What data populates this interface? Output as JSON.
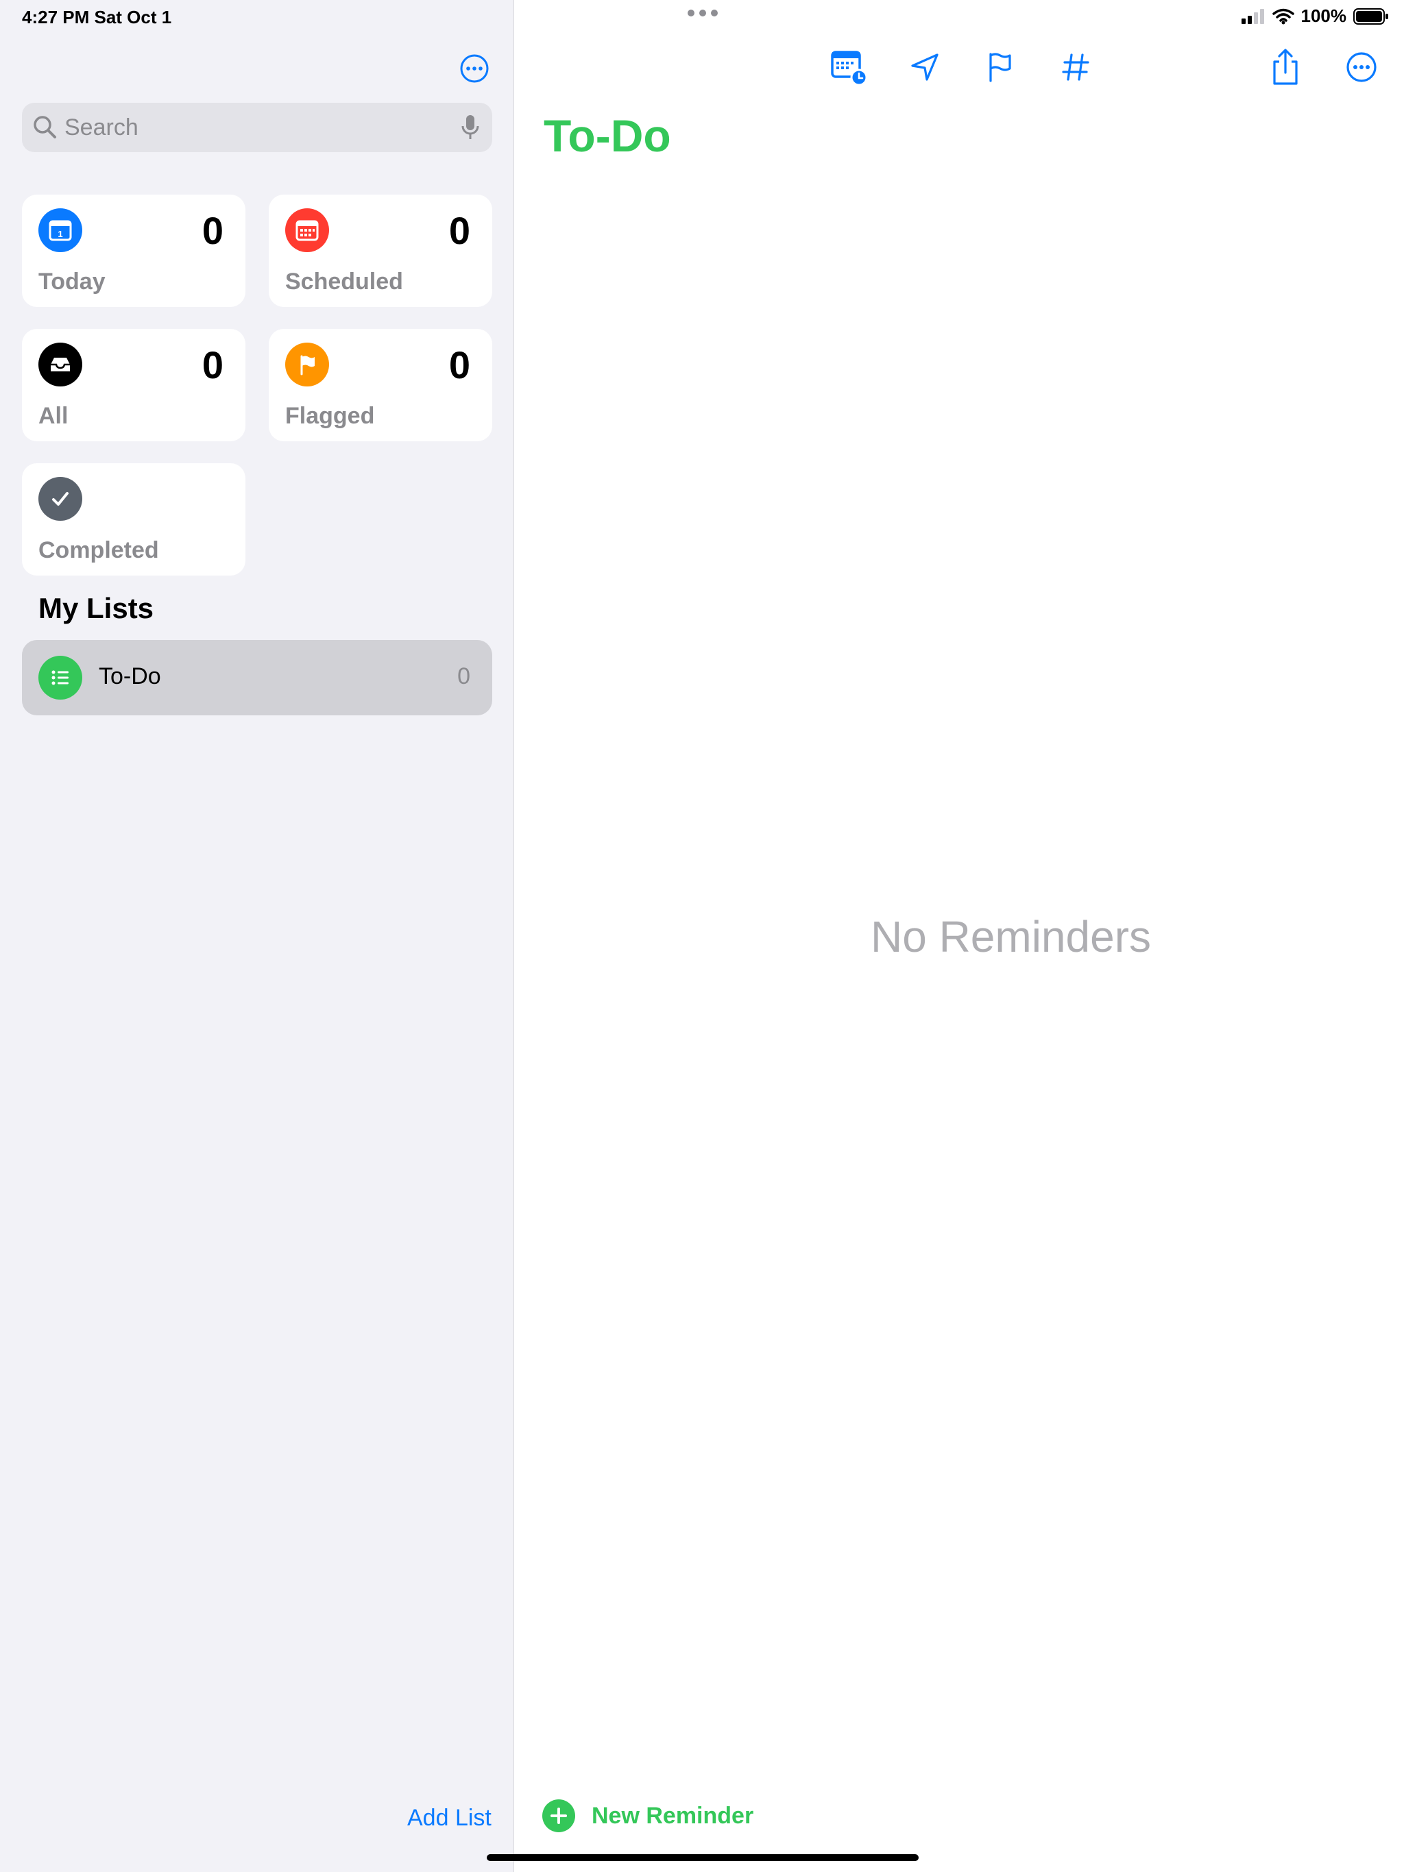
{
  "status_bar": {
    "time": "4:27 PM   Sat Oct 1",
    "battery": "100%"
  },
  "sidebar": {
    "search": {
      "placeholder": "Search"
    },
    "smart_lists": [
      {
        "label": "Today",
        "count": "0",
        "icon": "calendar-today-icon",
        "color": "#0a7aff",
        "day": "1"
      },
      {
        "label": "Scheduled",
        "count": "0",
        "icon": "calendar-icon",
        "color": "#ff3b30"
      },
      {
        "label": "All",
        "count": "0",
        "icon": "tray-icon",
        "color": "#000000"
      },
      {
        "label": "Flagged",
        "count": "0",
        "icon": "flag-icon",
        "color": "#ff9500"
      },
      {
        "label": "Completed",
        "icon": "checkmark-icon",
        "color": "#5a626c"
      }
    ],
    "my_lists_title": "My Lists",
    "lists": [
      {
        "name": "To-Do",
        "count": "0",
        "icon": "list-bullet-icon",
        "color": "#34c759"
      }
    ],
    "add_list_label": "Add List"
  },
  "main": {
    "title": "To-Do",
    "empty_message": "No Reminders",
    "new_reminder_label": "New Reminder",
    "toolbar": [
      "calendar-clock-icon",
      "location-icon",
      "flag-outline-icon",
      "hashtag-icon",
      "share-icon",
      "more-icon"
    ]
  },
  "colors": {
    "accent_blue": "#0a7aff",
    "accent_green": "#34c759"
  }
}
